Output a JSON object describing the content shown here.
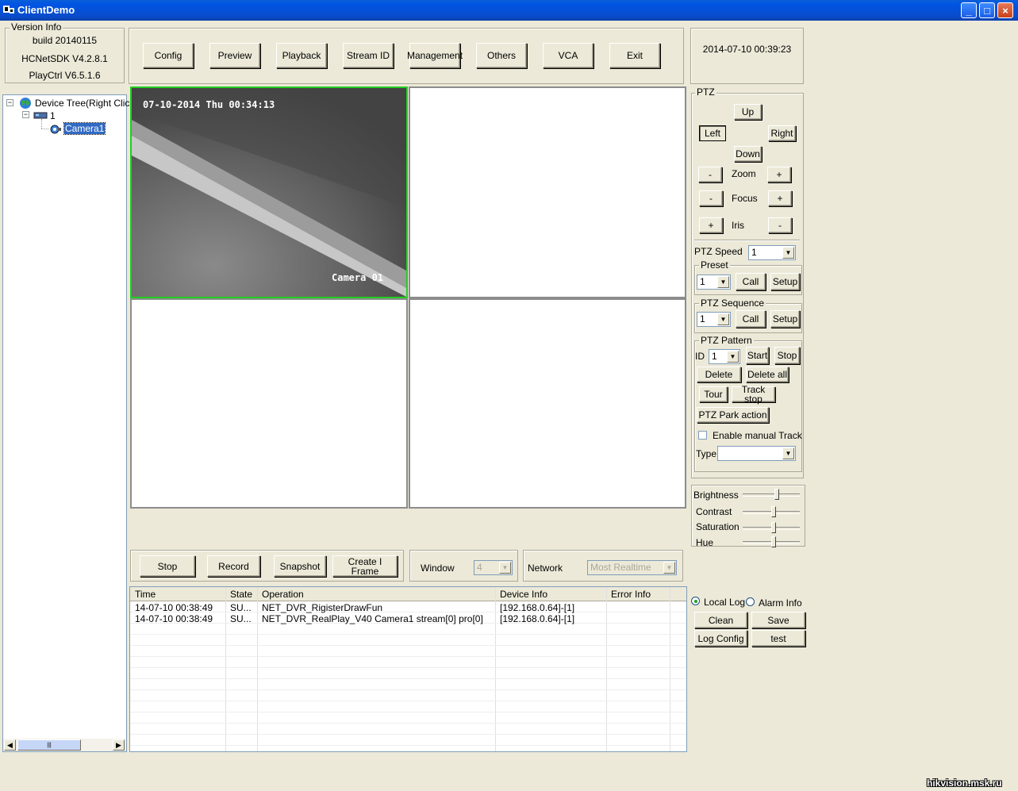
{
  "window": {
    "title": "ClientDemo",
    "controls": [
      "_",
      "□",
      "×"
    ]
  },
  "version_info": {
    "label": "Version Info",
    "build": "build 20140115",
    "sdk": "HCNetSDK V4.2.8.1",
    "playctrl": "PlayCtrl V6.5.1.6"
  },
  "toolbar": [
    "Config",
    "Preview",
    "Playback",
    "Stream ID",
    "Management",
    "Others",
    "VCA",
    "Exit"
  ],
  "datetime": "2014-07-10  00:39:23",
  "tree": {
    "root": "Device Tree(Right Click",
    "device": "1",
    "camera": "Camera1",
    "toggle": "−"
  },
  "video": {
    "osd_time": "07-10-2014 Thu 00:34:13",
    "osd_name": "Camera 01"
  },
  "ptz": {
    "label": "PTZ",
    "up": "Up",
    "left": "Left",
    "right": "Right",
    "down": "Down",
    "zoom": "Zoom",
    "focus": "Focus",
    "iris": "Iris",
    "minus": "-",
    "plus": "+",
    "speed_label": "PTZ Speed",
    "speed_value": "1",
    "preset_label": "Preset",
    "preset_value": "1",
    "sequence_label": "PTZ Sequence",
    "sequence_value": "1",
    "call": "Call",
    "setup": "Setup",
    "pattern_label": "PTZ Pattern",
    "id_label": "ID",
    "id_value": "1",
    "start": "Start",
    "stop": "Stop",
    "delete": "Delete",
    "delete_all": "Delete all",
    "tour": "Tour",
    "track_stop": "Track stop",
    "park": "PTZ Park action",
    "manual_track": "Enable manual Track",
    "type_label": "Type"
  },
  "image": {
    "brightness": "Brightness",
    "contrast": "Contrast",
    "saturation": "Saturation",
    "hue": "Hue",
    "levels": [
      0.6,
      0.55,
      0.55,
      0.55
    ]
  },
  "bottom_bar": {
    "stop": "Stop",
    "record": "Record",
    "snapshot": "Snapshot",
    "iframe": "Create I Frame",
    "window_label": "Window",
    "window_value": "4",
    "network_label": "Network",
    "network_value": "Most Realtime"
  },
  "log": {
    "columns": [
      "Time",
      "State",
      "Operation",
      "Device Info",
      "Error Info"
    ],
    "rows": [
      [
        "14-07-10 00:38:49",
        "SU...",
        "NET_DVR_RigisterDrawFun",
        "[192.168.0.64]-[1]",
        ""
      ],
      [
        "14-07-10 00:38:49",
        "SU...",
        "NET_DVR_RealPlay_V40 Camera1 stream[0] pro[0]",
        "[192.168.0.64]-[1]",
        ""
      ]
    ]
  },
  "log_panel": {
    "local_log": "Local Log",
    "alarm_info": "Alarm Info",
    "clean": "Clean",
    "save": "Save",
    "log_config": "Log Config",
    "test": "test"
  },
  "watermark": "hikvision.msk.ru",
  "colors": {
    "titlebar": "#0054e3",
    "face": "#ece9d8",
    "selected_border": "#22cc22"
  }
}
